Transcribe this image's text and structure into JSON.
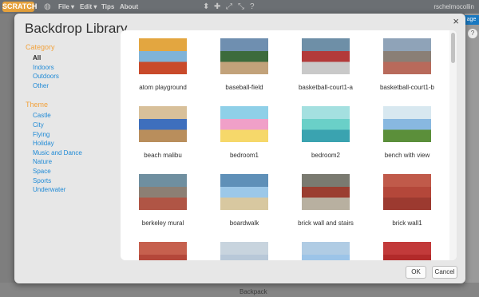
{
  "app": {
    "logo_text": "SCRATCH",
    "menus": [
      "File ▾",
      "Edit ▾",
      "Tips",
      "About"
    ],
    "username": "rschelmocollin",
    "stage_button": "age",
    "help_icon": "?",
    "backpack_label": "Backpack"
  },
  "modal": {
    "title": "Backdrop Library",
    "close_label": "×",
    "ok_label": "OK",
    "cancel_label": "Cancel"
  },
  "sidebar": {
    "category_title": "Category",
    "categories": [
      "All",
      "Indoors",
      "Outdoors",
      "Other"
    ],
    "selected_category": "All",
    "theme_title": "Theme",
    "themes": [
      "Castle",
      "City",
      "Flying",
      "Holiday",
      "Music and Dance",
      "Nature",
      "Space",
      "Sports",
      "Underwater"
    ]
  },
  "backdrops": [
    {
      "name": "atom playground",
      "colors": [
        "#7fb3d8",
        "#c94a2b",
        "#e3a640"
      ]
    },
    {
      "name": "baseball-field",
      "colors": [
        "#3c6b3c",
        "#c2a27a",
        "#6f8fb0"
      ]
    },
    {
      "name": "basketball-court1-a",
      "colors": [
        "#b33a3a",
        "#c9c9c9",
        "#6e8fa7"
      ]
    },
    {
      "name": "basketball-court1-b",
      "colors": [
        "#8a7f76",
        "#b86a5b",
        "#8fa3b8"
      ]
    },
    {
      "name": "beach malibu",
      "colors": [
        "#3e6fbd",
        "#b98e5c",
        "#d8c09a"
      ]
    },
    {
      "name": "bedroom1",
      "colors": [
        "#f0a0c8",
        "#f6d86a",
        "#8fd0e8"
      ]
    },
    {
      "name": "bedroom2",
      "colors": [
        "#6ad0c8",
        "#3aa3b0",
        "#a4e0e0"
      ]
    },
    {
      "name": "bench with view",
      "colors": [
        "#88b8e0",
        "#5b8f3a",
        "#d8e8f0"
      ]
    },
    {
      "name": "berkeley mural",
      "colors": [
        "#8c7f74",
        "#b05545",
        "#6f8fa0"
      ]
    },
    {
      "name": "boardwalk",
      "colors": [
        "#9cc8e8",
        "#d8c8a0",
        "#5f90b8"
      ]
    },
    {
      "name": "brick wall and stairs",
      "colors": [
        "#9b3e30",
        "#b8b0a0",
        "#7a7a70"
      ]
    },
    {
      "name": "brick wall1",
      "colors": [
        "#b4473a",
        "#9c3a30",
        "#c05a4a"
      ]
    },
    {
      "name": "",
      "colors": [
        "#b4473a",
        "#a0463a",
        "#c6604e"
      ]
    },
    {
      "name": "",
      "colors": [
        "#b8c8d8",
        "#9aa8b5",
        "#c8d4de"
      ]
    },
    {
      "name": "",
      "colors": [
        "#9cc4e8",
        "#dfe8f0",
        "#b0cce4"
      ]
    },
    {
      "name": "",
      "colors": [
        "#b22a2a",
        "#e8e0d0",
        "#c23a3a"
      ]
    }
  ]
}
